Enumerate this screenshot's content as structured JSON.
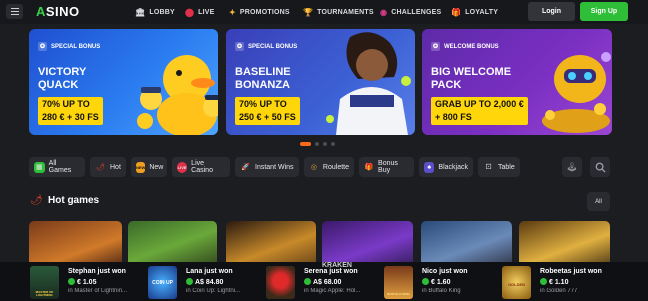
{
  "brand": {
    "logo_a": "A",
    "logo_rest": "SINO"
  },
  "nav": [
    {
      "label": "LOBBY",
      "icon": "lobby-icon"
    },
    {
      "label": "LIVE",
      "icon": "live-icon"
    },
    {
      "label": "PROMOTIONS",
      "icon": "promotions-icon"
    },
    {
      "label": "TOURNAMENTS",
      "icon": "trophy-icon"
    },
    {
      "label": "CHALLENGES",
      "icon": "challenges-icon"
    },
    {
      "label": "LOYALTY",
      "icon": "gift-icon"
    }
  ],
  "auth": {
    "login": "Login",
    "signup": "Sign Up"
  },
  "banners": [
    {
      "tag": "SPECIAL BONUS",
      "title1": "VICTORY",
      "title2": "QUACK",
      "offer1": "70% UP TO",
      "offer2": "280 € + 30 FS"
    },
    {
      "tag": "SPECIAL BONUS",
      "title1": "BASELINE",
      "title2": "BONANZA",
      "offer1": "70% UP TO",
      "offer2": "250 € + 50 FS"
    },
    {
      "tag": "WELCOME BONUS",
      "title1": "BIG WELCOME",
      "title2": "PACK",
      "offer1": "GRAB UP TO 2,000 €",
      "offer2": "+ 800 FS"
    }
  ],
  "categories": [
    {
      "label": "All Games",
      "icon": "grid-icon",
      "color": "#2fbe37"
    },
    {
      "label": "Hot",
      "icon": "chili-icon",
      "color": "#e0402a"
    },
    {
      "label": "New",
      "icon": "new-badge-icon",
      "color": "#f0a020"
    },
    {
      "label": "Live Casino",
      "icon": "live-badge-icon",
      "color": "#e0304a"
    },
    {
      "label": "Instant Wins",
      "icon": "rocket-icon",
      "color": "#c8c9ce"
    },
    {
      "label": "Roulette",
      "icon": "roulette-icon",
      "color": "#d8a030"
    },
    {
      "label": "Bonus Buy",
      "icon": "bonus-buy-icon",
      "color": "#e04050"
    },
    {
      "label": "Blackjack",
      "icon": "cards-icon",
      "color": "#9a8cff"
    },
    {
      "label": "Table",
      "icon": "dice-icon",
      "color": "#d0d1d6"
    }
  ],
  "section": {
    "title": "Hot games",
    "all": "All"
  },
  "wins": [
    {
      "who": "Stephan just won",
      "amount": "€ 1.05",
      "game": "in Master of Lightnin..."
    },
    {
      "who": "Lana just won",
      "amount": "A$ 84.80",
      "game": "in Coin Up: Lightni..."
    },
    {
      "who": "Serena just won",
      "amount": "A$ 68.00",
      "game": "in Magic Apple: Hol..."
    },
    {
      "who": "Nico just won",
      "amount": "€ 1.60",
      "game": "in Buffalo King"
    },
    {
      "who": "Robeetas just won",
      "amount": "€ 1.10",
      "game": "in Golden 777"
    }
  ],
  "thumb_text": {
    "master": "MASTER OF LIGHTNING",
    "coin": "COIN UP",
    "kraken": "KRAKEN",
    "buffalo": "BUFFALO KING",
    "golden": "GOLDEN"
  }
}
